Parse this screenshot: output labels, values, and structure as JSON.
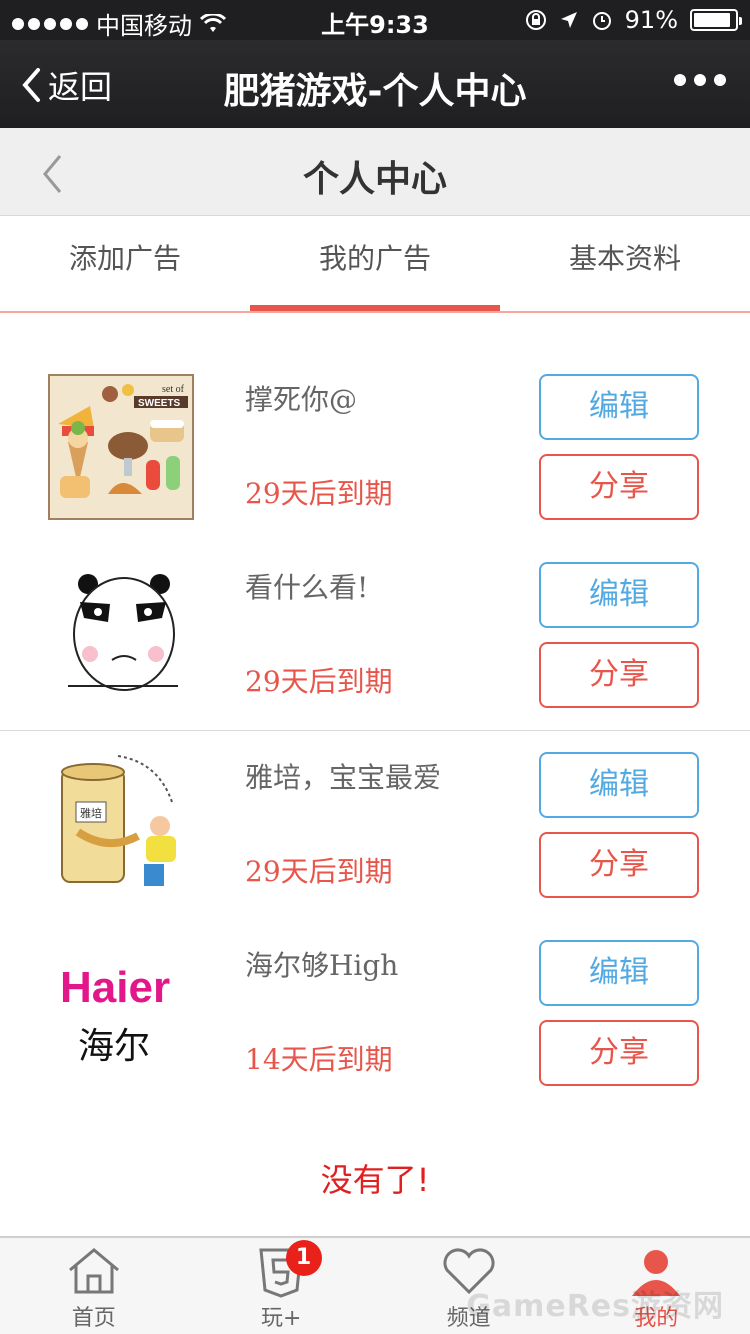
{
  "status": {
    "carrier": "中国移动",
    "time": "上午9:33",
    "battery": "91%",
    "battery_level": 0.91
  },
  "nav": {
    "back_label": "返回",
    "title": "肥猪游戏-个人中心"
  },
  "page": {
    "title": "个人中心"
  },
  "tabs": [
    {
      "label": "添加广告"
    },
    {
      "label": "我的广告"
    },
    {
      "label": "基本资料"
    }
  ],
  "ads": [
    {
      "name": "撑死你@",
      "expire": "29天后到期",
      "edit_label": "编辑",
      "share_label": "分享",
      "thumb": "sweets-icon",
      "thumb_text": "set of SWEETS"
    },
    {
      "name": "看什么看!",
      "expire": "29天后到期",
      "edit_label": "编辑",
      "share_label": "分享",
      "thumb": "panda-face-icon"
    },
    {
      "name": "雅培，宝宝最爱",
      "expire": "29天后到期",
      "edit_label": "编辑",
      "share_label": "分享",
      "thumb": "milk-powder-cartoon-icon",
      "thumb_text": "雅培"
    },
    {
      "name": "海尔够High",
      "expire": "14天后到期",
      "edit_label": "编辑",
      "share_label": "分享",
      "thumb": "haier-logo-icon",
      "thumb_text": "Haier",
      "thumb_text2": "海尔"
    }
  ],
  "footer_note": "没有了!",
  "tabbar": [
    {
      "label": "首页",
      "icon": "home-icon"
    },
    {
      "label": "玩+",
      "icon": "html5-icon",
      "badge": "1"
    },
    {
      "label": "频道",
      "icon": "heart-icon"
    },
    {
      "label": "我的",
      "icon": "user-icon"
    }
  ],
  "watermark": "GameRes游资网",
  "colors": {
    "accent_red": "#e8554a",
    "accent_blue": "#53a9e1",
    "dark_bar": "#1f1f21"
  }
}
